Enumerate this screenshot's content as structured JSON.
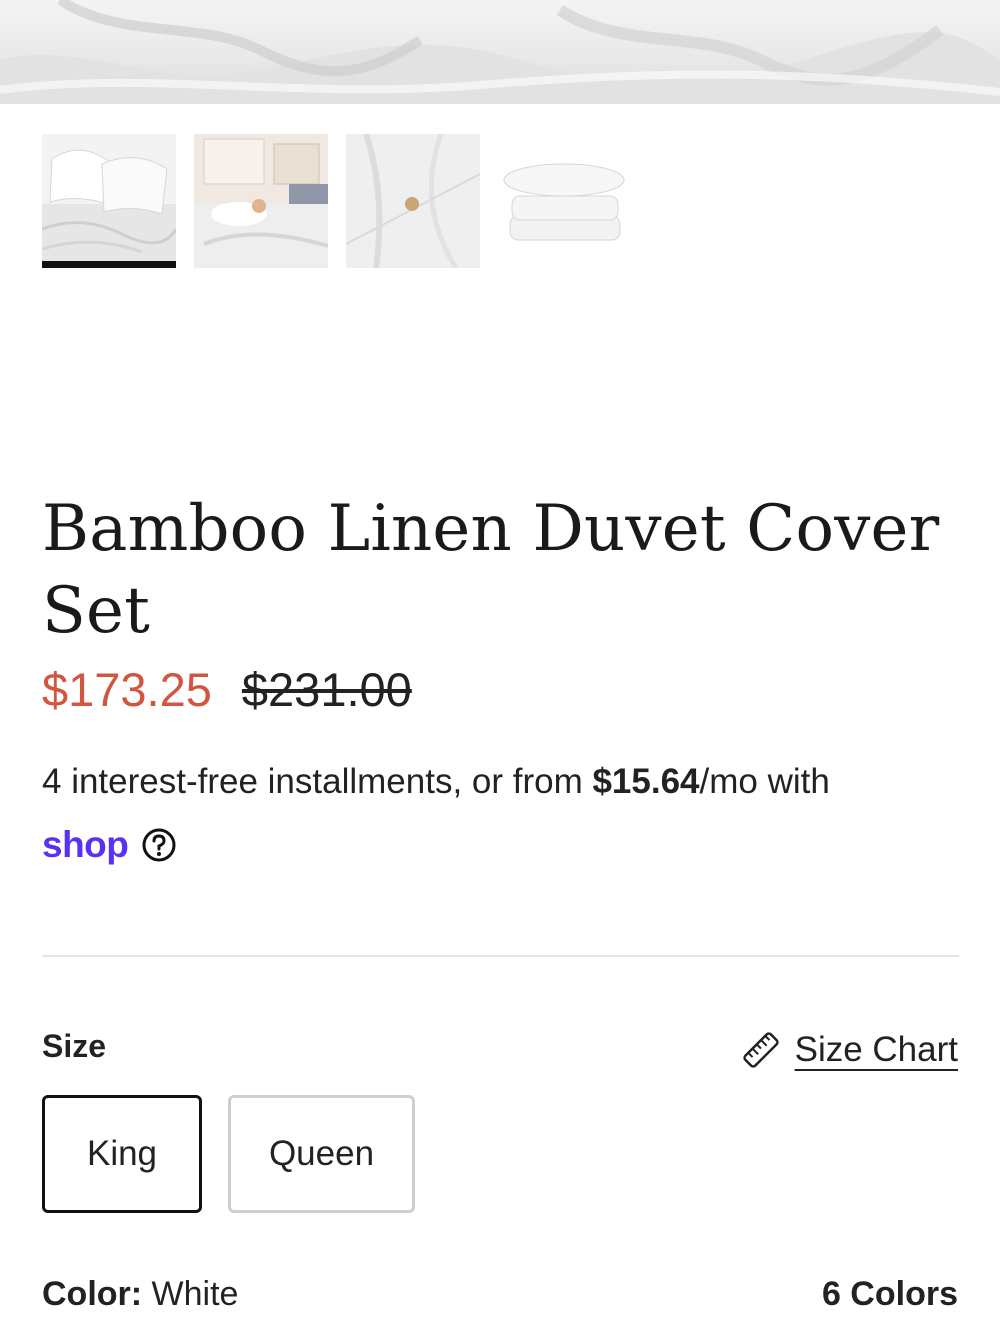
{
  "gallery": {
    "thumbnails": [
      {
        "label": "bedding-set-thumbnail",
        "selected": true
      },
      {
        "label": "woman-sleeping-thumbnail",
        "selected": false
      },
      {
        "label": "button-closure-thumbnail",
        "selected": false
      },
      {
        "label": "folded-stack-thumbnail",
        "selected": false
      }
    ]
  },
  "product": {
    "title": "Bamboo Linen Duvet Cover Set",
    "sale_price": "$173.25",
    "compare_price": "$231.00",
    "installments_prefix": "4 interest-free installments, or from ",
    "installments_amount": "$15.64",
    "installments_suffix": "/mo with",
    "shop_logo": "shop"
  },
  "size": {
    "label": "Size",
    "chart_label": "Size Chart",
    "options": [
      {
        "label": "King",
        "selected": true
      },
      {
        "label": "Queen",
        "selected": false
      }
    ]
  },
  "color": {
    "label": "Color:",
    "value": "White",
    "count": "6 Colors"
  },
  "colors": {
    "sale": "#d2553f",
    "shop_brand": "#5a31f4"
  },
  "icons": {
    "help": "question-circle-icon",
    "size_chart": "ruler-icon"
  }
}
